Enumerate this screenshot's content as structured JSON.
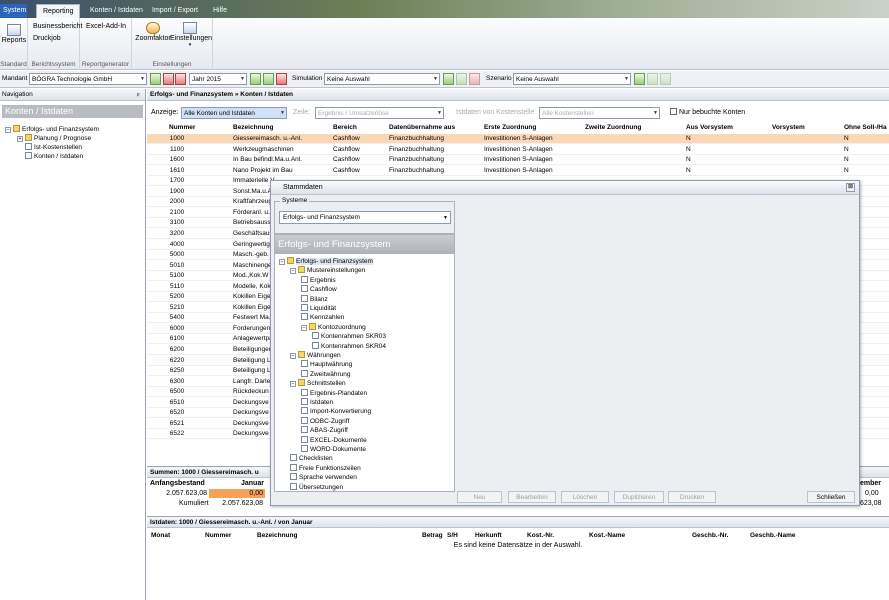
{
  "tabs": [
    "System",
    "Reporting",
    "Konten / Istdaten",
    "Import / Export",
    "Hilfe"
  ],
  "ribbon": {
    "groups": [
      {
        "label": "Standard",
        "items": [
          "Reports"
        ]
      },
      {
        "label": "Berichtssystem",
        "items": [
          "Businessbericht",
          "Druckjob"
        ]
      },
      {
        "label": "Reportgenerator",
        "items": [
          "Excel-Add-In"
        ]
      },
      {
        "label": "Einstellungen",
        "items": [
          "Zoomfaktor",
          "Einstellungen"
        ]
      }
    ]
  },
  "toolbar": {
    "mandant_label": "Mandant",
    "mandant_value": "BÖGRA Technologie GmbH",
    "jahr_value": "Jahr 2015",
    "simulation_label": "Simulation",
    "simulation_value": "Keine Auswahl",
    "szenario_label": "Szenario",
    "szenario_value": "Keine Auswahl"
  },
  "nav": {
    "header": "Navigation",
    "pin": "ᵖ",
    "title": "Konten / Istdaten",
    "tree": [
      "Erfolgs- und Finanzsystem",
      "Planung / Prognose",
      "Ist-Kostenstellen",
      "Konten / Istdaten"
    ]
  },
  "main": {
    "breadcrumb": "Erfolgs- und Finanzsystem » Konten / Istdaten",
    "filter": {
      "anzeige_label": "Anzeige:",
      "anzeige_value": "Alle Konten und Istdaten",
      "zeile_label": "Zeile:",
      "zeile_value": "Ergebnis / Umsatzerlöse",
      "kst_label": "Istdaten von Kostenstelle",
      "kst_value": "Alle Kostenstellen",
      "nur_label": "Nur bebuchte Konten"
    },
    "columns": [
      "Nummer",
      "Bezeichnung",
      "Bereich",
      "Datenübernahme aus",
      "Erste Zuordnung",
      "Zweite Zuordnung",
      "Aus Vorsystem",
      "Vorsystem",
      "Ohne Soll-/Ha"
    ],
    "rows": [
      [
        "1000",
        "Giessereimasch. u.-Anl.",
        "Cashflow",
        "Finanzbuchhaltung",
        "Investitionen S-Anlagen",
        "",
        "N",
        "",
        "N"
      ],
      [
        "1100",
        "Werkzeugmaschinen",
        "Cashflow",
        "Finanzbuchhaltung",
        "Investitionen S-Anlagen",
        "",
        "N",
        "",
        "N"
      ],
      [
        "1600",
        "In Bau befindl.Ma.u.Anl.",
        "Cashflow",
        "Finanzbuchhaltung",
        "Investitionen S-Anlagen",
        "",
        "N",
        "",
        "N"
      ],
      [
        "1610",
        "Nano Projekt im Bau",
        "Cashflow",
        "Finanzbuchhaltung",
        "Investitionen S-Anlagen",
        "",
        "N",
        "",
        "N"
      ],
      [
        "1700",
        "Immaterielle V",
        "",
        "",
        "",
        "",
        "",
        "",
        ""
      ],
      [
        "1900",
        "Sonst.Ma.u.A",
        "",
        "",
        "",
        "",
        "",
        "",
        ""
      ],
      [
        "2000",
        "Kraftfahrzeug",
        "",
        "",
        "",
        "",
        "",
        "",
        ""
      ],
      [
        "2100",
        "Förderanl. u.",
        "",
        "",
        "",
        "",
        "",
        "",
        ""
      ],
      [
        "3100",
        "Betriebsauss",
        "",
        "",
        "",
        "",
        "",
        "",
        ""
      ],
      [
        "3200",
        "Geschäftsaus",
        "",
        "",
        "",
        "",
        "",
        "",
        ""
      ],
      [
        "4000",
        "Geringwertige",
        "",
        "",
        "",
        "",
        "",
        "",
        ""
      ],
      [
        "5000",
        "Masch.-geb.",
        "",
        "",
        "",
        "",
        "",
        "",
        ""
      ],
      [
        "5010",
        "Maschinenge",
        "",
        "",
        "",
        "",
        "",
        "",
        ""
      ],
      [
        "5100",
        "Mod.,Kok.W",
        "",
        "",
        "",
        "",
        "",
        "",
        ""
      ],
      [
        "5110",
        "Modelle, Kok",
        "",
        "",
        "",
        "",
        "",
        "",
        ""
      ],
      [
        "5200",
        "Kokillen Eige",
        "",
        "",
        "",
        "",
        "",
        "",
        ""
      ],
      [
        "5210",
        "Kokillen Eige",
        "",
        "",
        "",
        "",
        "",
        "",
        ""
      ],
      [
        "5400",
        "Festwert Ma.",
        "",
        "",
        "",
        "",
        "",
        "",
        ""
      ],
      [
        "6000",
        "Forderungen",
        "",
        "",
        "",
        "",
        "",
        "",
        ""
      ],
      [
        "6100",
        "Anlagewertpa",
        "",
        "",
        "",
        "",
        "",
        "",
        ""
      ],
      [
        "6200",
        "Beteiligungen",
        "",
        "",
        "",
        "",
        "",
        "",
        ""
      ],
      [
        "6220",
        "Beteiligung L",
        "",
        "",
        "",
        "",
        "",
        "",
        ""
      ],
      [
        "6250",
        "Beteiligung L",
        "",
        "",
        "",
        "",
        "",
        "",
        ""
      ],
      [
        "6300",
        "Langfr. Darle",
        "",
        "",
        "",
        "",
        "",
        "",
        ""
      ],
      [
        "6500",
        "Rückdeckun",
        "",
        "",
        "",
        "",
        "",
        "",
        ""
      ],
      [
        "6510",
        "Deckungsve",
        "",
        "",
        "",
        "",
        "",
        "",
        ""
      ],
      [
        "6520",
        "Deckungsve",
        "",
        "",
        "",
        "",
        "",
        "",
        ""
      ],
      [
        "6521",
        "Deckungsve",
        "",
        "",
        "",
        "",
        "",
        "",
        ""
      ],
      [
        "6522",
        "Deckungsve",
        "",
        "",
        "",
        "",
        "",
        "",
        ""
      ]
    ],
    "summen": {
      "title": "Summen: 1000 / Giessereimasch. u",
      "anfangsbestand_label": "Anfangsbestand",
      "januar_label": "Januar",
      "anfangsbestand_value": "2.057.623,08",
      "januar_value": "0,00",
      "kumuliert_label": "Kumuliert",
      "kumuliert_value": "2.057.623,08",
      "right_label": "ember",
      "right_value1": "0,00",
      "right_value2": "623,08"
    },
    "istdaten": {
      "title": "Istdaten: 1000 / Giessereimasch. u.-Anl. / von Januar",
      "columns": [
        "Monat",
        "Nummer",
        "Bezeichnung",
        "Betrag",
        "S/H",
        "Herkunft",
        "Kost.-Nr.",
        "Kost.-Name",
        "Geschb.-Nr.",
        "Geschb.-Name"
      ],
      "empty": "Es sind keine Datensätze in der Auswahl."
    }
  },
  "dialog": {
    "title": "Stammdaten",
    "close": "⊠",
    "systeme_caption": "Systeme",
    "systeme_value": "Erfolgs- und Finanzsystem",
    "tree_header": "Erfolgs- und Finanzsystem",
    "tree": [
      {
        "label": "Erfolgs- und Finanzsystem",
        "level": 0,
        "type": "root"
      },
      {
        "label": "Mustereinstellungen",
        "level": 1,
        "type": "folder"
      },
      {
        "label": "Ergebnis",
        "level": 2,
        "type": "doc"
      },
      {
        "label": "Cashflow",
        "level": 2,
        "type": "doc"
      },
      {
        "label": "Bilanz",
        "level": 2,
        "type": "doc"
      },
      {
        "label": "Liquidität",
        "level": 2,
        "type": "doc"
      },
      {
        "label": "Kennzahlen",
        "level": 2,
        "type": "doc"
      },
      {
        "label": "Kontozuordnung",
        "level": 2,
        "type": "folder"
      },
      {
        "label": "Kontenrahmen SKR03",
        "level": 3,
        "type": "doc"
      },
      {
        "label": "Kontenrahmen SKR04",
        "level": 3,
        "type": "doc"
      },
      {
        "label": "Währungen",
        "level": 1,
        "type": "folder"
      },
      {
        "label": "Hauptwährung",
        "level": 2,
        "type": "doc"
      },
      {
        "label": "Zweitwährung",
        "level": 2,
        "type": "doc"
      },
      {
        "label": "Schnittstellen",
        "level": 1,
        "type": "folder"
      },
      {
        "label": "Ergebnis-Plandaten",
        "level": 2,
        "type": "doc"
      },
      {
        "label": "Istdaten",
        "level": 2,
        "type": "doc"
      },
      {
        "label": "Import-Konvertierung",
        "level": 2,
        "type": "doc"
      },
      {
        "label": "ODBC-Zugriff",
        "level": 2,
        "type": "doc"
      },
      {
        "label": "ABAS-Zugriff",
        "level": 2,
        "type": "doc"
      },
      {
        "label": "EXCEL-Dokumente",
        "level": 2,
        "type": "doc"
      },
      {
        "label": "WORD-Dokumente",
        "level": 2,
        "type": "doc"
      },
      {
        "label": "Checklisten",
        "level": 1,
        "type": "doc"
      },
      {
        "label": "Freie Funktionszeilen",
        "level": 1,
        "type": "doc"
      },
      {
        "label": "Sprache verwenden",
        "level": 1,
        "type": "doc"
      },
      {
        "label": "Übersetzungen",
        "level": 1,
        "type": "doc"
      }
    ],
    "buttons": [
      "Neu",
      "Bearbeiten",
      "Löschen",
      "Duplizieren",
      "Drucken",
      "Schließen"
    ]
  }
}
